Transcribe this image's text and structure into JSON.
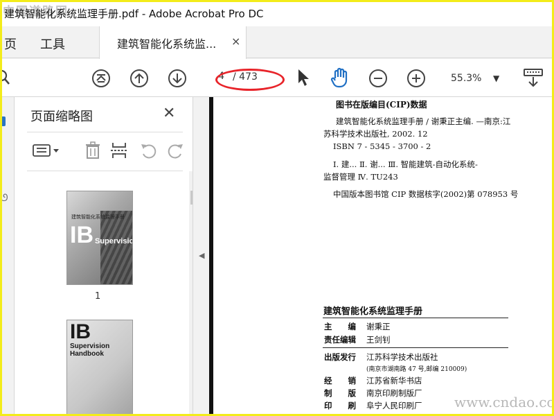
{
  "window": {
    "title": "建筑智能化系统监理手册.pdf - Adobe Acrobat Pro DC",
    "watermark": "中国道路网"
  },
  "tabs": {
    "home": "页",
    "tools": "工具",
    "doc": "建筑智能化系统监...",
    "close": "×"
  },
  "toolbar": {
    "page_current": "4",
    "page_total": "/ 473",
    "zoom": "55.3%"
  },
  "sidebar": {
    "title": "页面缩略图",
    "close": "✕",
    "thumb1_label": "1",
    "thumb1_cn": "建筑智能化系统监理手册",
    "thumb1_letters": "IB",
    "thumb1_word": "Supervision",
    "thumb2_letters": "IB",
    "thumb2_word": "Supervision Handbook"
  },
  "document": {
    "cip_heading": "图书在版编目(CIP)数据",
    "cip_lines": [
      "建筑智能化系统监理手册 / 谢秉正主编. —南京:江",
      "苏科学技术出版社, 2002. 12",
      "ISBN 7 - 5345 - 3700 - 2",
      "Ⅰ. 建...   Ⅱ. 谢...   Ⅲ. 智能建筑-自动化系统-",
      "监督管理   Ⅳ. TU243",
      "中国版本图书馆 CIP 数据核字(2002)第 078953 号"
    ],
    "book_title": "建筑智能化系统监理手册",
    "colophon": [
      {
        "k": "主　　编",
        "v": "谢秉正"
      },
      {
        "k": "责任编辑",
        "v": "王剑钊"
      },
      {
        "k": "出版发行",
        "v": "江苏科学技术出版社"
      },
      {
        "k": "经　　销",
        "v": "江苏省新华书店"
      },
      {
        "k": "制　　版",
        "v": "南京印刷制版厂"
      },
      {
        "k": "印　　刷",
        "v": "阜宁人民印刷厂"
      }
    ],
    "address": "(南京市湖南路 47 号,邮编 210009)"
  },
  "site_watermark": "www.cndao.com",
  "colors": {
    "accent_blue": "#1f6fc4",
    "highlight_red": "#e8242a",
    "frame_yellow": "#f3ec1a"
  }
}
